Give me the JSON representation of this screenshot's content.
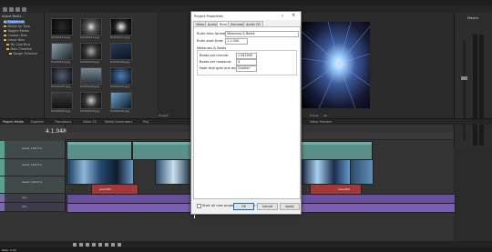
{
  "explorer": {
    "toolbar_label": "Import Media...",
    "tree": [
      {
        "label": "Sequences"
      },
      {
        "label": "Media by Type"
      },
      {
        "label": "Tagged Media"
      },
      {
        "label": "Custom Bins"
      },
      {
        "label": "Smart Bins"
      },
      {
        "label": "My Cool Bins"
      },
      {
        "label": "Main Timeline"
      },
      {
        "label": "Rough Timeline"
      }
    ],
    "thumbs": [
      "DCIM0016.jpg",
      "DCIM0015.jpg",
      "DCIM0013.jpg",
      "DCIM0010.jpg",
      "DCIM0009.jpg",
      "DCIM0008.jpg",
      "DCIM0007.jpg",
      "DCIM0006.jpg",
      "DCIM0005.jpg",
      "DCIM0004.jpg",
      "DCIM0003.jpg",
      "DCIM0002.jpg"
    ]
  },
  "panel_tabs": [
    "Project Media",
    "Explorer",
    "Transitions",
    "Video FX",
    "Media Generators",
    "Proj"
  ],
  "preview_tab": "Video Preview",
  "preview_info": {
    "project": "Project:",
    "preview": "Preview:",
    "display": "Display:",
    "frame": "Frame:",
    "frame_value": "99",
    "display_value": "196x196x32"
  },
  "master": {
    "title": "Master"
  },
  "timeline": {
    "timecode": "4.1.048",
    "tracks": [
      {
        "label": "Level: 100.0 %"
      },
      {
        "label": "Level: 100.0 %"
      },
      {
        "label": "Level: 100.0 %"
      },
      {
        "label": "Vol:"
      },
      {
        "label": "Vol:"
      }
    ],
    "audio_labels": [
      "sound01",
      "sound02"
    ],
    "status_text": "Rate: 0.00"
  },
  "dialog": {
    "title": "Project Properties",
    "close_label": "×",
    "help_label": "?",
    "tabs": [
      "Video",
      "Audio",
      "Ruler",
      "Summary",
      "Audio CD"
    ],
    "active_tab": "Ruler",
    "ruler_time_format_label": "Ruler time format:",
    "ruler_time_format_value": "Measures & Beats",
    "ruler_start_time_label": "Ruler start time:",
    "ruler_start_time_value": "1.1.000",
    "measures_group_label": "Measures & Beats",
    "bpm_label": "Beats per minute:",
    "bpm_value": "1.942000",
    "bpmeasure_label": "Beats per measure:",
    "bpmeasure_value": "4",
    "note_label": "Note that gets one beat:",
    "note_value": "Quarter",
    "start_all_label": "Start all new projects with these settings",
    "ok_label": "OK",
    "cancel_label": "Cancel",
    "apply_label": "Apply"
  }
}
